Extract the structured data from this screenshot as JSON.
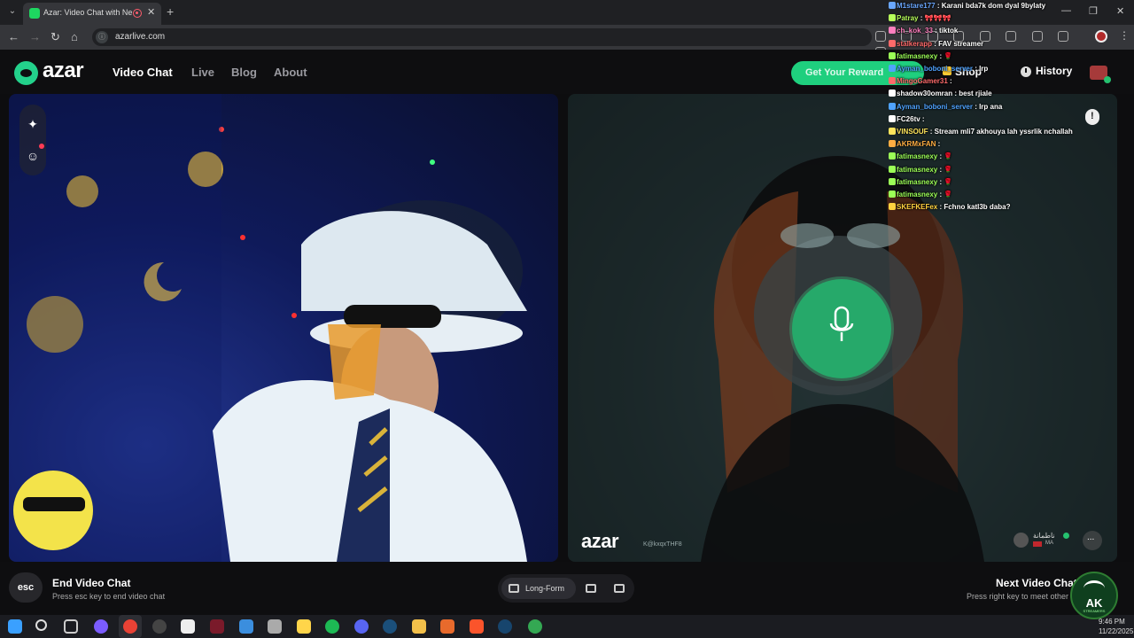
{
  "browser": {
    "tab_title": "Azar: Video Chat with New",
    "url": "azarlive.com",
    "tab_favicon": "azar-favicon"
  },
  "header": {
    "logo": "azar",
    "nav": [
      {
        "label": "Video Chat",
        "active": true
      },
      {
        "label": "Live",
        "active": false
      },
      {
        "label": "Blog",
        "active": false
      },
      {
        "label": "About",
        "active": false
      }
    ],
    "reward_button": "Get Your Reward",
    "shop_label": "Shop",
    "history_label": "History"
  },
  "video_right": {
    "watermark": "azar",
    "session_id": "K@kxqxTHF8",
    "peer_name": "ناطمانة",
    "peer_country": "MA"
  },
  "controls": {
    "esc_key": "esc",
    "end_title": "End Video Chat",
    "end_hint": "Press esc key to end video chat",
    "layout_label": "Long-Form",
    "next_title": "Next Video Chat",
    "next_hint": "Press right key to meet other"
  },
  "taskbar": {
    "time": "9:46 PM",
    "date": "11/22/2025"
  },
  "stream_chat": [
    {
      "user": "M1stare177",
      "message": "Karani bda7k dom dyal 9bylaty",
      "color": "#6aa7ff"
    },
    {
      "user": "Patray",
      "message": "🎀🎀🎀",
      "color": "#b8ff5a"
    },
    {
      "user": "ch_kok_33",
      "message": "tiktok",
      "color": "#ff7fbf"
    },
    {
      "user": "stalkerapp",
      "message": "FAV streamer",
      "color": "#ff6a6a"
    },
    {
      "user": "fatimasnexy",
      "message": "🌹",
      "color": "#9cff57"
    },
    {
      "user": "Ayman_boboni_server",
      "message": "lrp",
      "color": "#4fa3ff"
    },
    {
      "user": "MingoGamer31",
      "message": "",
      "color": "#ff6b6b"
    },
    {
      "user": "shadow30omran",
      "message": "best rjiale",
      "color": "#ffffff"
    },
    {
      "user": "Ayman_boboni_server",
      "message": "lrp ana",
      "color": "#4fa3ff"
    },
    {
      "user": "FC26tv",
      "message": "",
      "color": "#ffffff"
    },
    {
      "user": "VINSOUF",
      "message": "Stream mli7 akhouya lah yssrlik nchallah",
      "color": "#ffe55c"
    },
    {
      "user": "AKRMxFAN",
      "message": "",
      "color": "#ffae42"
    },
    {
      "user": "fatimasnexy",
      "message": "🌹",
      "color": "#9cff57"
    },
    {
      "user": "fatimasnexy",
      "message": "🌹",
      "color": "#9cff57"
    },
    {
      "user": "fatimasnexy",
      "message": "🌹",
      "color": "#9cff57"
    },
    {
      "user": "fatimasnexy",
      "message": "🌹",
      "color": "#9cff57"
    },
    {
      "user": "SKEFKEFex",
      "message": "Fchno katl3b daba?",
      "color": "#ffd23f"
    }
  ],
  "overlay_badge": {
    "title": "AK",
    "subtitle": "STREAMERS"
  },
  "colors": {
    "accent": "#1fcf7e",
    "mic_button": "#26a96a",
    "background": "#0e0e10"
  }
}
